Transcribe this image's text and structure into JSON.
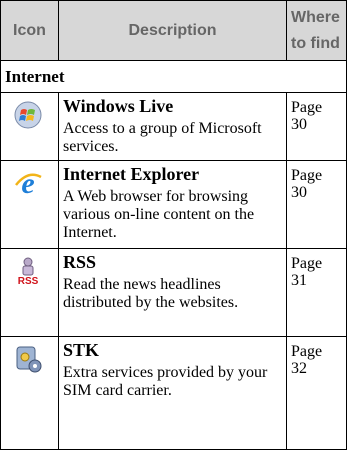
{
  "header": {
    "icon_col": "Icon",
    "description_col": "Description",
    "where_col": "Where to find"
  },
  "section": {
    "label": "Internet"
  },
  "rows": [
    {
      "icon": "windows-live-icon",
      "title": "Windows Live",
      "description": "Access to a group of Microsoft services.",
      "page": "Page 30"
    },
    {
      "icon": "internet-explorer-icon",
      "title": "Internet Explorer",
      "description": "A Web browser for browsing various on-line content on the Internet.",
      "page": "Page 30"
    },
    {
      "icon": "rss-icon",
      "title": "RSS",
      "description": "Read the news headlines distributed by the websites.",
      "page": "Page 31"
    },
    {
      "icon": "stk-icon",
      "title": "STK",
      "description": "Extra services provided by your SIM card carrier.",
      "page": "Page 32"
    }
  ]
}
